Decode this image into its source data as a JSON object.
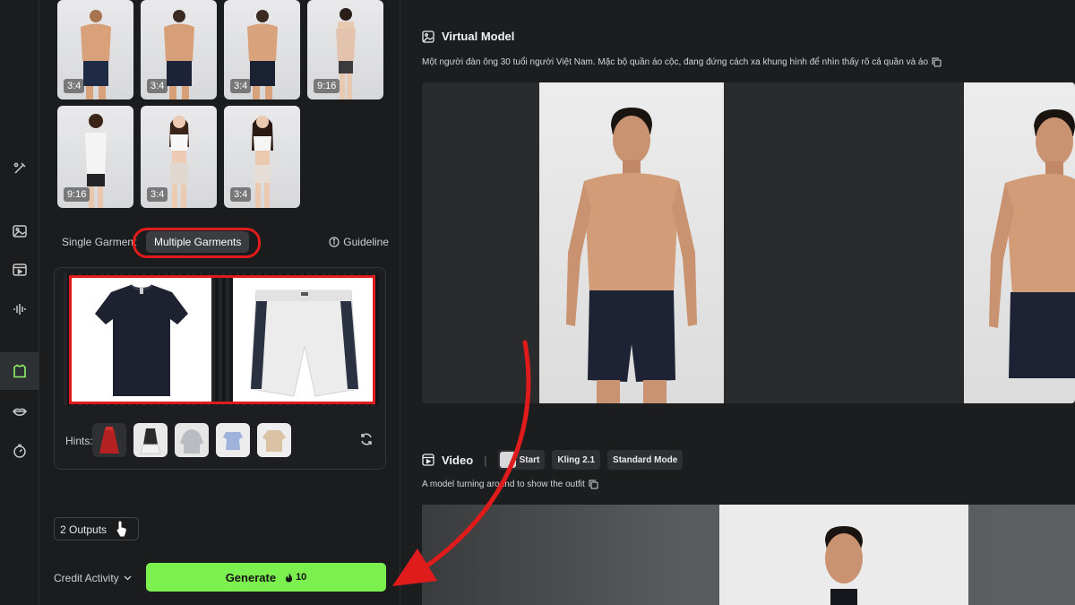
{
  "rail": {
    "icons": [
      "magic-wand-icon",
      "image-icon",
      "video-clip-icon",
      "audio-wave-icon",
      "tshirt-icon",
      "lips-icon",
      "timer-icon"
    ]
  },
  "models": {
    "thumbs": [
      {
        "ratio": "3:4",
        "type": "male-model"
      },
      {
        "ratio": "3:4",
        "type": "male-model"
      },
      {
        "ratio": "3:4",
        "type": "male-model"
      },
      {
        "ratio": "9:16",
        "type": "female-model"
      },
      {
        "ratio": "9:16",
        "type": "female-model"
      },
      {
        "ratio": "3:4",
        "type": "female-model"
      },
      {
        "ratio": "3:4",
        "type": "female-model"
      }
    ]
  },
  "garment_tabs": {
    "single": "Single Garment",
    "multiple": "Multiple Garments",
    "guideline": "Guideline"
  },
  "garments": {
    "items": [
      "black-shirt",
      "white-shorts"
    ]
  },
  "hints": {
    "label": "Hints:",
    "items": [
      "red-dress",
      "dark-dress",
      "grey-hoodie",
      "blue-top",
      "beige-shirt"
    ]
  },
  "outputs": {
    "label": "2 Outputs"
  },
  "credit": {
    "label": "Credit Activity"
  },
  "generate": {
    "label": "Generate",
    "cost": "10"
  },
  "virtual_model": {
    "title": "Virtual Model",
    "prompt": "Một người đàn ông 30 tuổi người Việt Nam. Mặc bộ quần áo cộc, đang đứng cách xa khung hình để nhìn thấy rõ cả quần và áo"
  },
  "video": {
    "title": "Video",
    "chips": [
      "Start",
      "Kling 2.1",
      "Standard Mode"
    ],
    "prompt": "A model turning around to show the outfit"
  },
  "colors": {
    "accent": "#7cf04f",
    "highlight_red": "#e01b1b",
    "panel_bg": "#1b1c1e"
  }
}
